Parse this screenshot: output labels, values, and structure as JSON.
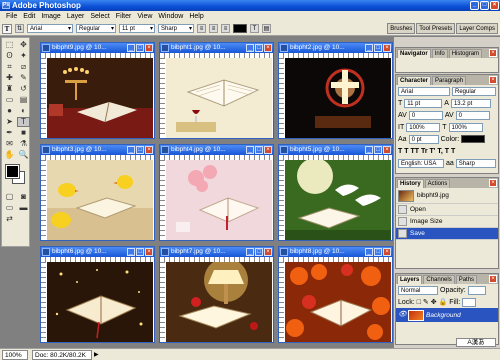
{
  "app": {
    "title": "Adobe Photoshop",
    "icon": "ps-app-icon"
  },
  "menu": [
    "File",
    "Edit",
    "Image",
    "Layer",
    "Select",
    "Filter",
    "View",
    "Window",
    "Help"
  ],
  "options": {
    "tool_glyph": "T",
    "font_family": "Arial",
    "font_style": "Regular",
    "font_size": "11 pt",
    "anti_alias": "Sharp",
    "wells": [
      "Brushes",
      "Tool Presets",
      "Layer Comps"
    ]
  },
  "documents": [
    {
      "title": "bibpht9.jpg @ 10...",
      "scene": "menorah"
    },
    {
      "title": "bibpht1.jpg @ 10...",
      "scene": "bible-wine"
    },
    {
      "title": "bibpht2.jpg @ 10...",
      "scene": "cross-light"
    },
    {
      "title": "bibpht3.jpg @ 10...",
      "scene": "chicks"
    },
    {
      "title": "bibpht4.jpg @ 10...",
      "scene": "roses"
    },
    {
      "title": "bibpht5.jpg @ 10...",
      "scene": "doves"
    },
    {
      "title": "bibpht6.jpg @ 10...",
      "scene": "sparkles"
    },
    {
      "title": "bibpht7.jpg @ 10...",
      "scene": "lamp"
    },
    {
      "title": "bibpht8.jpg @ 10...",
      "scene": "fruit"
    }
  ],
  "navigator": {
    "tabs": [
      "Navigator",
      "Info",
      "Histogram"
    ]
  },
  "character": {
    "tabs": [
      "Character",
      "Paragraph"
    ],
    "font": "Arial",
    "style": "Regular",
    "size": "11 pt",
    "leading": "13.2 pt",
    "kerning": "0",
    "tracking": "0",
    "vscale": "100%",
    "hscale": "100%",
    "baseline": "0 pt",
    "color_label": "Color:",
    "language": "English: USA",
    "aa": "Sharp"
  },
  "history": {
    "tabs": [
      "History",
      "Actions"
    ],
    "snapshot": "bibpht9.jpg",
    "steps": [
      "Open",
      "Image Size",
      "Save"
    ]
  },
  "layers": {
    "tabs": [
      "Layers",
      "Channels",
      "Paths"
    ],
    "mode": "Normal",
    "opacity_label": "Opacity:",
    "lock_label": "Lock:",
    "fill_label": "Fill:",
    "layer": "Background"
  },
  "status": {
    "zoom": "100%",
    "doc": "Doc: 80.2K/80.2K",
    "ime": "A漢あ"
  }
}
